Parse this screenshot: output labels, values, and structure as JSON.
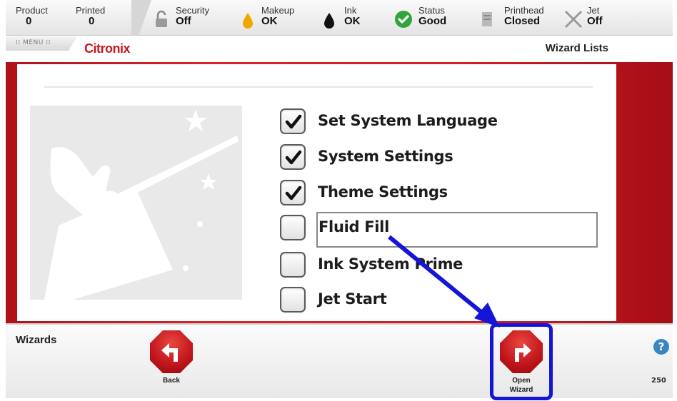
{
  "status_bar": {
    "product": {
      "label": "Product",
      "value": "0"
    },
    "printed": {
      "label": "Printed",
      "value": "0"
    },
    "security": {
      "label": "Security",
      "value": "Off",
      "icon": "padlock-icon"
    },
    "makeup": {
      "label": "Makeup",
      "value": "OK",
      "icon": "makeup-drop-icon",
      "color": "#f0a800"
    },
    "ink": {
      "label": "Ink",
      "value": "OK",
      "icon": "ink-drop-icon",
      "color": "#111111"
    },
    "status": {
      "label": "Status",
      "value": "Good",
      "icon": "check-circle-icon",
      "color": "#33a33a"
    },
    "printhead": {
      "label": "Printhead",
      "value": "Closed",
      "icon": "printhead-icon"
    },
    "jet": {
      "label": "Jet",
      "value": "Off",
      "icon": "x-icon"
    }
  },
  "header": {
    "menu_label": "MENU",
    "logo": "Citronix",
    "page_title": "Wizard Lists"
  },
  "wizard_list": [
    {
      "label": "Set System Language",
      "checked": true
    },
    {
      "label": "System Settings",
      "checked": true
    },
    {
      "label": "Theme Settings",
      "checked": true
    },
    {
      "label": "Fluid Fill",
      "checked": false,
      "selected": true
    },
    {
      "label": "Ink System Prime",
      "checked": false
    },
    {
      "label": "Jet Start",
      "checked": false
    }
  ],
  "footer": {
    "title": "Wizards",
    "back_label": "Back",
    "open_label_line1": "Open",
    "open_label_line2": "Wizard",
    "help": "?",
    "version": "250"
  },
  "colors": {
    "brand_red": "#c8171f",
    "highlight_blue": "#1515d8",
    "help_blue": "#3a86c2"
  }
}
